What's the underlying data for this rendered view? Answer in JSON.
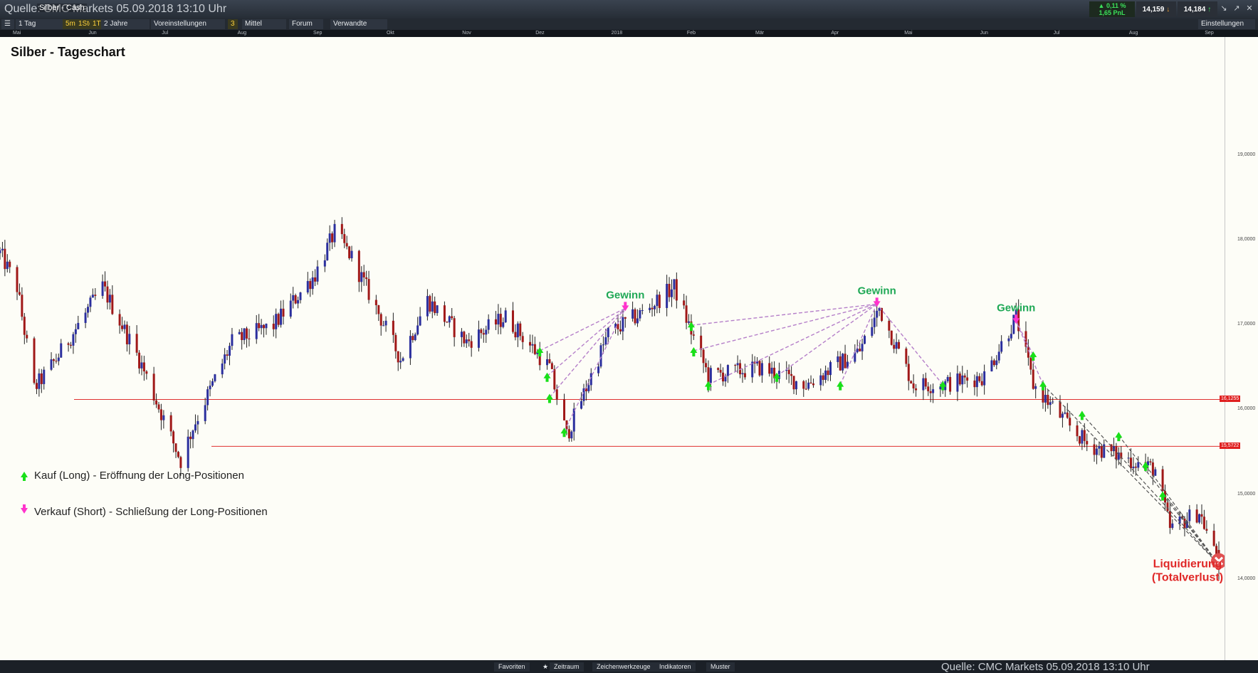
{
  "header": {
    "source_overlay": "Quelle: CMC Markets 05.09.2018 13:10 Uhr",
    "instrument": "Silber - Cash",
    "change_pct": "▲ 0,11 %",
    "change_pnl": "1,65 PnL",
    "sell_price": "14,159",
    "buy_price": "14,184"
  },
  "toolbar": {
    "interval": "1 Tag",
    "btn_5m": "5m",
    "btn_1std": "1Std",
    "btn_1t": "1T",
    "range": "2 Jahre",
    "presets": "Voreinstellungen",
    "count": "3",
    "average": "Mittel",
    "forum": "Forum",
    "related": "Verwandte",
    "settings": "Einstellungen"
  },
  "time_axis": [
    "Mai",
    "Jun",
    "Jul",
    "Aug",
    "Sep",
    "Okt",
    "Nov",
    "Dez",
    "2018",
    "Feb",
    "Mär",
    "Apr",
    "Mai",
    "Jun",
    "Jul",
    "Aug",
    "Sep"
  ],
  "chart_data": {
    "type": "candlestick",
    "title": "Silber - Tageschart",
    "x_range": [
      "2017-04-24",
      "2018-09-05"
    ],
    "ylim": [
      13.05,
      20.4
    ],
    "y_ticks": [
      "19,0000",
      "18,0000",
      "17,0000",
      "16,0000",
      "15,0000",
      "14,0000"
    ],
    "y_tick_values": [
      19,
      18,
      17,
      16,
      15,
      14
    ],
    "support_levels": [
      {
        "label": "16,1255",
        "value": 16.1255
      },
      {
        "label": "15,5722",
        "value": 15.5722
      }
    ],
    "anchors": [
      {
        "date": "2017-04-24",
        "close": 17.85
      },
      {
        "date": "2017-05-01",
        "close": 17.45
      },
      {
        "date": "2017-05-08",
        "close": 16.25
      },
      {
        "date": "2017-05-17",
        "close": 16.6
      },
      {
        "date": "2017-06-05",
        "close": 17.45
      },
      {
        "date": "2017-06-20",
        "close": 16.6
      },
      {
        "date": "2017-07-07",
        "close": 15.4
      },
      {
        "date": "2017-07-12",
        "close": 15.8
      },
      {
        "date": "2017-07-28",
        "close": 16.8
      },
      {
        "date": "2017-08-14",
        "close": 17.0
      },
      {
        "date": "2017-08-31",
        "close": 17.6
      },
      {
        "date": "2017-09-08",
        "close": 18.1
      },
      {
        "date": "2017-09-15",
        "close": 17.8
      },
      {
        "date": "2017-10-05",
        "close": 16.6
      },
      {
        "date": "2017-10-16",
        "close": 17.3
      },
      {
        "date": "2017-11-01",
        "close": 16.8
      },
      {
        "date": "2017-11-17",
        "close": 17.1
      },
      {
        "date": "2017-12-05",
        "close": 16.5
      },
      {
        "date": "2017-12-12",
        "close": 15.7
      },
      {
        "date": "2017-12-29",
        "close": 16.9
      },
      {
        "date": "2018-01-12",
        "close": 17.15
      },
      {
        "date": "2018-01-25",
        "close": 17.45
      },
      {
        "date": "2018-02-08",
        "close": 16.4
      },
      {
        "date": "2018-03-01",
        "close": 16.5
      },
      {
        "date": "2018-03-20",
        "close": 16.3
      },
      {
        "date": "2018-04-11",
        "close": 16.7
      },
      {
        "date": "2018-04-19",
        "close": 17.2
      },
      {
        "date": "2018-05-03",
        "close": 16.3
      },
      {
        "date": "2018-05-15",
        "close": 16.3
      },
      {
        "date": "2018-06-01",
        "close": 16.4
      },
      {
        "date": "2018-06-14",
        "close": 17.1
      },
      {
        "date": "2018-06-21",
        "close": 16.3
      },
      {
        "date": "2018-07-03",
        "close": 15.9
      },
      {
        "date": "2018-07-13",
        "close": 15.6
      },
      {
        "date": "2018-07-27",
        "close": 15.45
      },
      {
        "date": "2018-08-10",
        "close": 15.3
      },
      {
        "date": "2018-08-16",
        "close": 14.6
      },
      {
        "date": "2018-08-28",
        "close": 14.8
      },
      {
        "date": "2018-09-05",
        "close": 14.18
      }
    ],
    "long_entries": [
      {
        "date": "2017-12-01",
        "price": 16.7
      },
      {
        "date": "2017-12-04",
        "price": 16.4
      },
      {
        "date": "2017-12-05",
        "price": 16.15
      },
      {
        "date": "2017-12-11",
        "price": 15.75
      },
      {
        "date": "2018-02-01",
        "price": 17.0
      },
      {
        "date": "2018-02-02",
        "price": 16.7
      },
      {
        "date": "2018-02-08",
        "price": 16.3
      },
      {
        "date": "2018-03-08",
        "price": 16.4
      },
      {
        "date": "2018-04-03",
        "price": 16.3
      },
      {
        "date": "2018-05-15",
        "price": 16.3
      },
      {
        "date": "2018-06-21",
        "price": 16.65
      },
      {
        "date": "2018-06-25",
        "price": 16.3
      },
      {
        "date": "2018-07-11",
        "price": 15.95
      },
      {
        "date": "2018-07-26",
        "price": 15.7
      },
      {
        "date": "2018-08-06",
        "price": 15.35
      },
      {
        "date": "2018-08-13",
        "price": 15.0
      }
    ],
    "short_exits": [
      {
        "date": "2018-01-05",
        "price": 17.2
      },
      {
        "date": "2018-04-18",
        "price": 17.25
      },
      {
        "date": "2018-06-14",
        "price": 17.05
      }
    ],
    "annotations": {
      "profit_label": "Gewinn",
      "liquidation_line1": "Liquidierung",
      "liquidation_line2": "(Totalverlust)"
    },
    "legend": [
      {
        "marker": "long",
        "color": "#19e019",
        "label": "Kauf (Long) - Eröffnung der Long-Positionen"
      },
      {
        "marker": "short",
        "color": "#ff33cc",
        "label": "Verkauf (Short) - Schließung der Long-Positionen"
      }
    ],
    "colors": {
      "up": "#2b2f9e",
      "down": "#a01818",
      "level_line": "#e03030",
      "profit_text": "#1ea855",
      "loss_text": "#e02828",
      "fan_profit": "#b57fc9",
      "fan_loss": "#555555"
    }
  },
  "bottom": {
    "favorites": "Favoriten",
    "timeframe": "Zeitraum",
    "drawing_tools": "Zeichenwerkzeuge",
    "indicators": "Indikatoren",
    "patterns": "Muster",
    "source": "Quelle: CMC Markets 05.09.2018 13:10 Uhr"
  }
}
